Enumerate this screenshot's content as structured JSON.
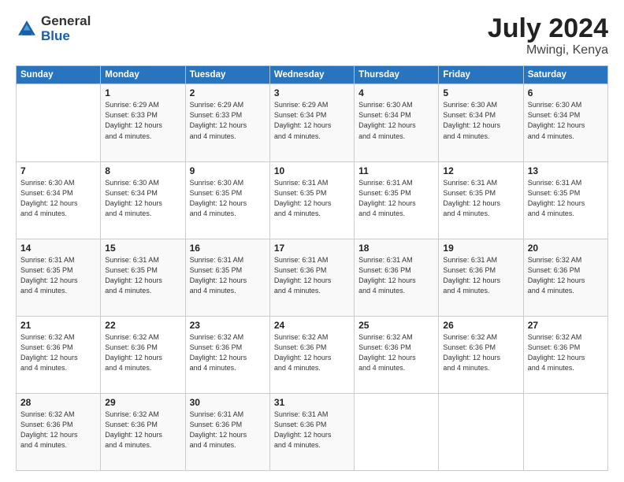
{
  "logo": {
    "general": "General",
    "blue": "Blue"
  },
  "title": {
    "month_year": "July 2024",
    "location": "Mwingi, Kenya"
  },
  "days_header": [
    "Sunday",
    "Monday",
    "Tuesday",
    "Wednesday",
    "Thursday",
    "Friday",
    "Saturday"
  ],
  "weeks": [
    [
      {
        "day": "",
        "sunrise": "",
        "sunset": "",
        "daylight": ""
      },
      {
        "day": "1",
        "sunrise": "Sunrise: 6:29 AM",
        "sunset": "Sunset: 6:33 PM",
        "daylight": "Daylight: 12 hours and 4 minutes."
      },
      {
        "day": "2",
        "sunrise": "Sunrise: 6:29 AM",
        "sunset": "Sunset: 6:33 PM",
        "daylight": "Daylight: 12 hours and 4 minutes."
      },
      {
        "day": "3",
        "sunrise": "Sunrise: 6:29 AM",
        "sunset": "Sunset: 6:34 PM",
        "daylight": "Daylight: 12 hours and 4 minutes."
      },
      {
        "day": "4",
        "sunrise": "Sunrise: 6:30 AM",
        "sunset": "Sunset: 6:34 PM",
        "daylight": "Daylight: 12 hours and 4 minutes."
      },
      {
        "day": "5",
        "sunrise": "Sunrise: 6:30 AM",
        "sunset": "Sunset: 6:34 PM",
        "daylight": "Daylight: 12 hours and 4 minutes."
      },
      {
        "day": "6",
        "sunrise": "Sunrise: 6:30 AM",
        "sunset": "Sunset: 6:34 PM",
        "daylight": "Daylight: 12 hours and 4 minutes."
      }
    ],
    [
      {
        "day": "7",
        "sunrise": "Sunrise: 6:30 AM",
        "sunset": "Sunset: 6:34 PM",
        "daylight": "Daylight: 12 hours and 4 minutes."
      },
      {
        "day": "8",
        "sunrise": "Sunrise: 6:30 AM",
        "sunset": "Sunset: 6:34 PM",
        "daylight": "Daylight: 12 hours and 4 minutes."
      },
      {
        "day": "9",
        "sunrise": "Sunrise: 6:30 AM",
        "sunset": "Sunset: 6:35 PM",
        "daylight": "Daylight: 12 hours and 4 minutes."
      },
      {
        "day": "10",
        "sunrise": "Sunrise: 6:31 AM",
        "sunset": "Sunset: 6:35 PM",
        "daylight": "Daylight: 12 hours and 4 minutes."
      },
      {
        "day": "11",
        "sunrise": "Sunrise: 6:31 AM",
        "sunset": "Sunset: 6:35 PM",
        "daylight": "Daylight: 12 hours and 4 minutes."
      },
      {
        "day": "12",
        "sunrise": "Sunrise: 6:31 AM",
        "sunset": "Sunset: 6:35 PM",
        "daylight": "Daylight: 12 hours and 4 minutes."
      },
      {
        "day": "13",
        "sunrise": "Sunrise: 6:31 AM",
        "sunset": "Sunset: 6:35 PM",
        "daylight": "Daylight: 12 hours and 4 minutes."
      }
    ],
    [
      {
        "day": "14",
        "sunrise": "Sunrise: 6:31 AM",
        "sunset": "Sunset: 6:35 PM",
        "daylight": "Daylight: 12 hours and 4 minutes."
      },
      {
        "day": "15",
        "sunrise": "Sunrise: 6:31 AM",
        "sunset": "Sunset: 6:35 PM",
        "daylight": "Daylight: 12 hours and 4 minutes."
      },
      {
        "day": "16",
        "sunrise": "Sunrise: 6:31 AM",
        "sunset": "Sunset: 6:35 PM",
        "daylight": "Daylight: 12 hours and 4 minutes."
      },
      {
        "day": "17",
        "sunrise": "Sunrise: 6:31 AM",
        "sunset": "Sunset: 6:36 PM",
        "daylight": "Daylight: 12 hours and 4 minutes."
      },
      {
        "day": "18",
        "sunrise": "Sunrise: 6:31 AM",
        "sunset": "Sunset: 6:36 PM",
        "daylight": "Daylight: 12 hours and 4 minutes."
      },
      {
        "day": "19",
        "sunrise": "Sunrise: 6:31 AM",
        "sunset": "Sunset: 6:36 PM",
        "daylight": "Daylight: 12 hours and 4 minutes."
      },
      {
        "day": "20",
        "sunrise": "Sunrise: 6:32 AM",
        "sunset": "Sunset: 6:36 PM",
        "daylight": "Daylight: 12 hours and 4 minutes."
      }
    ],
    [
      {
        "day": "21",
        "sunrise": "Sunrise: 6:32 AM",
        "sunset": "Sunset: 6:36 PM",
        "daylight": "Daylight: 12 hours and 4 minutes."
      },
      {
        "day": "22",
        "sunrise": "Sunrise: 6:32 AM",
        "sunset": "Sunset: 6:36 PM",
        "daylight": "Daylight: 12 hours and 4 minutes."
      },
      {
        "day": "23",
        "sunrise": "Sunrise: 6:32 AM",
        "sunset": "Sunset: 6:36 PM",
        "daylight": "Daylight: 12 hours and 4 minutes."
      },
      {
        "day": "24",
        "sunrise": "Sunrise: 6:32 AM",
        "sunset": "Sunset: 6:36 PM",
        "daylight": "Daylight: 12 hours and 4 minutes."
      },
      {
        "day": "25",
        "sunrise": "Sunrise: 6:32 AM",
        "sunset": "Sunset: 6:36 PM",
        "daylight": "Daylight: 12 hours and 4 minutes."
      },
      {
        "day": "26",
        "sunrise": "Sunrise: 6:32 AM",
        "sunset": "Sunset: 6:36 PM",
        "daylight": "Daylight: 12 hours and 4 minutes."
      },
      {
        "day": "27",
        "sunrise": "Sunrise: 6:32 AM",
        "sunset": "Sunset: 6:36 PM",
        "daylight": "Daylight: 12 hours and 4 minutes."
      }
    ],
    [
      {
        "day": "28",
        "sunrise": "Sunrise: 6:32 AM",
        "sunset": "Sunset: 6:36 PM",
        "daylight": "Daylight: 12 hours and 4 minutes."
      },
      {
        "day": "29",
        "sunrise": "Sunrise: 6:32 AM",
        "sunset": "Sunset: 6:36 PM",
        "daylight": "Daylight: 12 hours and 4 minutes."
      },
      {
        "day": "30",
        "sunrise": "Sunrise: 6:31 AM",
        "sunset": "Sunset: 6:36 PM",
        "daylight": "Daylight: 12 hours and 4 minutes."
      },
      {
        "day": "31",
        "sunrise": "Sunrise: 6:31 AM",
        "sunset": "Sunset: 6:36 PM",
        "daylight": "Daylight: 12 hours and 4 minutes."
      },
      {
        "day": "",
        "sunrise": "",
        "sunset": "",
        "daylight": ""
      },
      {
        "day": "",
        "sunrise": "",
        "sunset": "",
        "daylight": ""
      },
      {
        "day": "",
        "sunrise": "",
        "sunset": "",
        "daylight": ""
      }
    ]
  ]
}
